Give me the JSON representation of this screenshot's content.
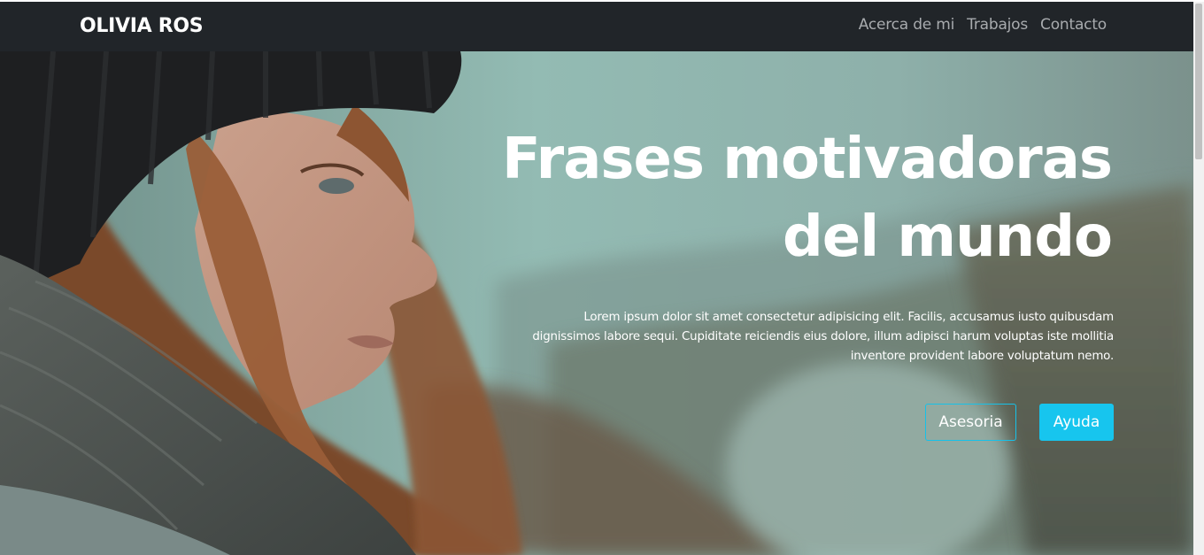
{
  "navbar": {
    "brand": "OLIVIA ROS",
    "links": [
      {
        "label": "Acerca de mi"
      },
      {
        "label": "Trabajos"
      },
      {
        "label": "Contacto"
      }
    ],
    "background": "#212529"
  },
  "hero": {
    "title_line1": "Frases motivadoras",
    "title_line2": "del mundo",
    "text_line1": "Lorem ipsum dolor sit amet consectetur adipisicing elit. Facilis, accusamus iusto quibusdam",
    "text_line2": "dignissimos labore sequi. Cupiditate reiciendis eius dolore, illum adipisci harum voluptas iste mollitia",
    "text_line3": "inventore provident labore voluptatum nemo.",
    "buttons": {
      "outline_label": "Asesoria",
      "solid_label": "Ayuda"
    },
    "accent": "#17c5ee"
  }
}
